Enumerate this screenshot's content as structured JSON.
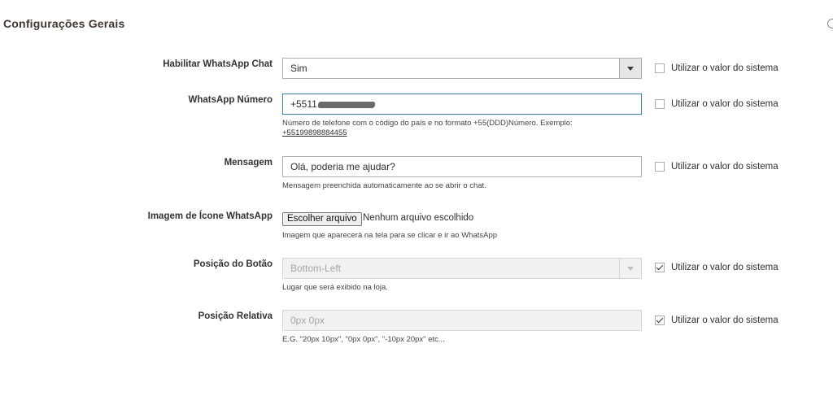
{
  "section": {
    "title": "Configurações Gerais"
  },
  "fields": {
    "enable": {
      "label": "Habilitar WhatsApp Chat",
      "value": "Sim",
      "use_system": "Utilizar o valor do sistema"
    },
    "number": {
      "label": "WhatsApp Número",
      "value": "+5511",
      "note": "Número de telefone com o código do país e no formato +55(DDD)Número. Exemplo:",
      "example": "+55199898884455",
      "use_system": "Utilizar o valor do sistema"
    },
    "message": {
      "label": "Mensagem",
      "value": "Olá, poderia me ajudar?",
      "note": "Mensagem preenchida automaticamente ao se abrir o chat.",
      "use_system": "Utilizar o valor do sistema"
    },
    "icon": {
      "label": "Imagem de Ícone WhatsApp",
      "button": "Escolher arquivo",
      "status": "Nenhum arquivo escolhido",
      "note": "Imagem que aparecerá na tela para se clicar e ir ao WhatsApp"
    },
    "position": {
      "label": "Posição do Botão",
      "value": "Bottom-Left",
      "note": "Lugar que será exibido na loja.",
      "use_system": "Utilizar o valor do sistema"
    },
    "relative": {
      "label": "Posição Relativa",
      "placeholder": "0px 0px",
      "note": "E.G. \"20px 10px\", \"0px 0px\", \"-10px 20px\" etc...",
      "use_system": "Utilizar o valor do sistema"
    }
  }
}
